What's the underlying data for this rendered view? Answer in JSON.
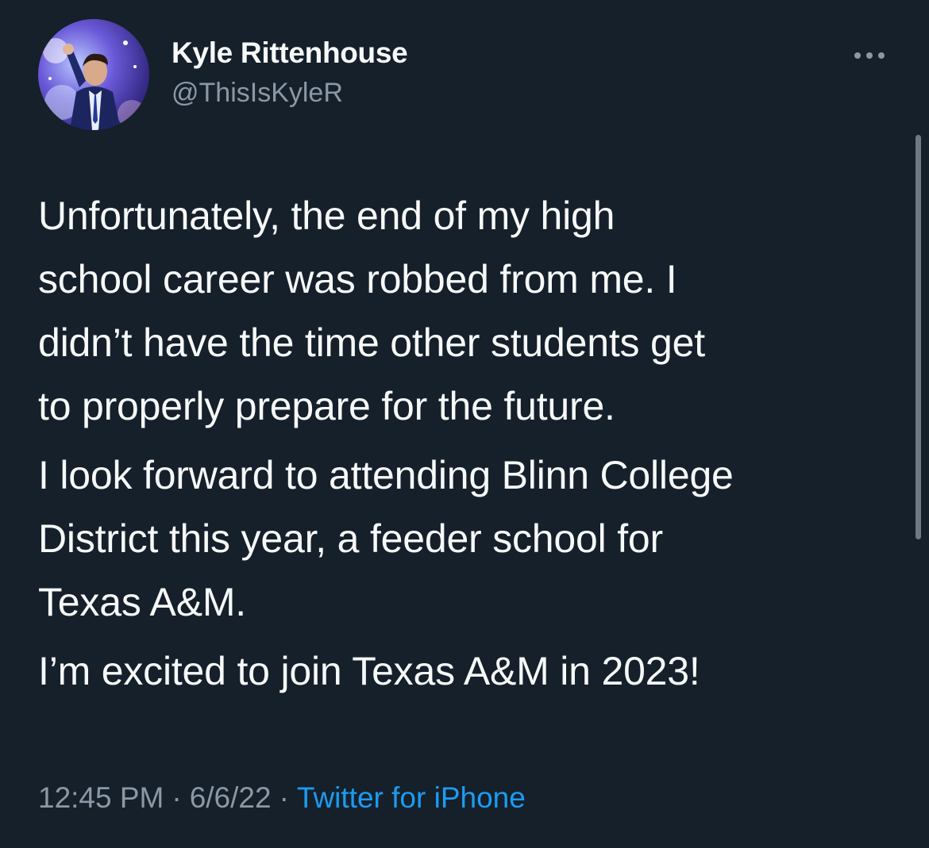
{
  "author": {
    "display_name": "Kyle Rittenhouse",
    "handle": "@ThisIsKyleR",
    "avatar_icon": "profile-photo"
  },
  "more_icon": "ellipsis-icon",
  "tweet": {
    "paragraphs": [
      "Unfortunately, the end of my high\nschool career was robbed from me. I\ndidn’t have the time other students get\nto properly prepare for the future.",
      "I look forward to attending Blinn College\nDistrict this year, a feeder school for\nTexas A&M.",
      "I’m excited to join Texas A&M in 2023!"
    ],
    "time": "12:45 PM",
    "date": "6/6/22",
    "source": "Twitter for iPhone",
    "separator": "·"
  },
  "colors": {
    "background": "#15202b",
    "text_primary": "#f7f9f9",
    "text_secondary": "#8b98a5",
    "accent": "#1d9bf0"
  }
}
